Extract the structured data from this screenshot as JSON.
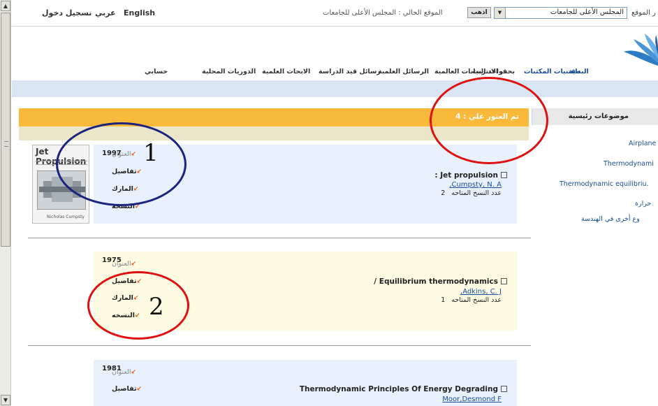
{
  "topbar": {
    "lang_english": "English",
    "lang_arabic": "عربي",
    "login": "تسجيل دخول",
    "current_location": "الموقع الحالي : المجلس الأعلى للجامعات",
    "go_button": "اذهب",
    "site_select_value": "المجلس الأعلى للجامعات",
    "site_label": "ر الموقع"
  },
  "nav": {
    "items": [
      "البداية",
      "مقتنيات المكتبات",
      "بحث الانترنت",
      "قواعد البيانات العالمية",
      "الرسائل العلمية",
      "رسائل قيد الدراسة",
      "الابحاث العلمية",
      "الدوريات المحلية",
      "حسابي"
    ]
  },
  "sidebar": {
    "heading": "موضوعات رئيسية",
    "items": [
      "Airplane",
      "Thermodynami",
      "Thermodynamic equilibriu.",
      "حرارة",
      "وع أخرى في الهندسة"
    ]
  },
  "results": {
    "heading": "تم العثور علي : 4",
    "actions": {
      "title": "العنوان",
      "details": "تفاصيل",
      "marc": "المارك",
      "copies": "النسخه"
    },
    "copies_label": "عدد النسخ المتاحه",
    "records": [
      {
        "year": "1997",
        "title": ": Jet propulsion",
        "author": ",Cumpsty, N. A",
        "copies": "2"
      },
      {
        "year": "1975",
        "title": "/ Equilibrium thermodynamics",
        "author": ",Adkins, C. J",
        "copies": "1"
      },
      {
        "year": "1981",
        "title": "Thermodynamic Principles Of Energy Degrading",
        "author": "Moor,Desmond F"
      }
    ],
    "cover": {
      "title": "Jet Propulsion",
      "author": "Nicholas Cumpsty"
    }
  },
  "annotations": [
    {
      "label": "1",
      "color": "#1a237e"
    },
    {
      "label": "2",
      "color": "#e01010"
    }
  ],
  "colors": {
    "accent_orange": "#f9b93a",
    "nav_strip": "#d9e4f4",
    "link_blue": "#1a4c9c",
    "annotation_red": "#e01010",
    "annotation_navy": "#1a237e"
  }
}
